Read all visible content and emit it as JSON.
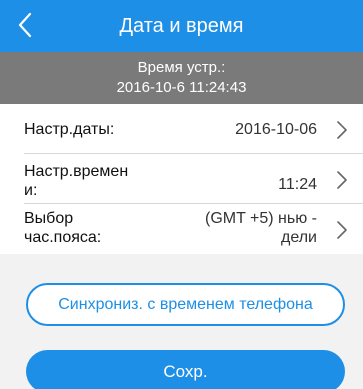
{
  "header": {
    "title": "Дата и время",
    "back_icon": "chevron-left-icon"
  },
  "device_time": {
    "label": "Время устр.:",
    "value": "2016-10-6 11:24:43"
  },
  "settings": {
    "date": {
      "label": "Настр.даты:",
      "value": "2016-10-06"
    },
    "time": {
      "label_line1": "Настр.времен",
      "label_line2": "и:",
      "value": "11:24"
    },
    "timezone": {
      "label_line1": "Выбор",
      "label_line2": "час.пояса:",
      "value_line1": "(GMT +5) нью -",
      "value_line2": "дели"
    }
  },
  "buttons": {
    "sync_label": "Синхрониз. с временем телефона",
    "save_label": "Сохр."
  },
  "colors": {
    "accent": "#1e8fe6",
    "device_time_bg": "#7a7a7a"
  }
}
